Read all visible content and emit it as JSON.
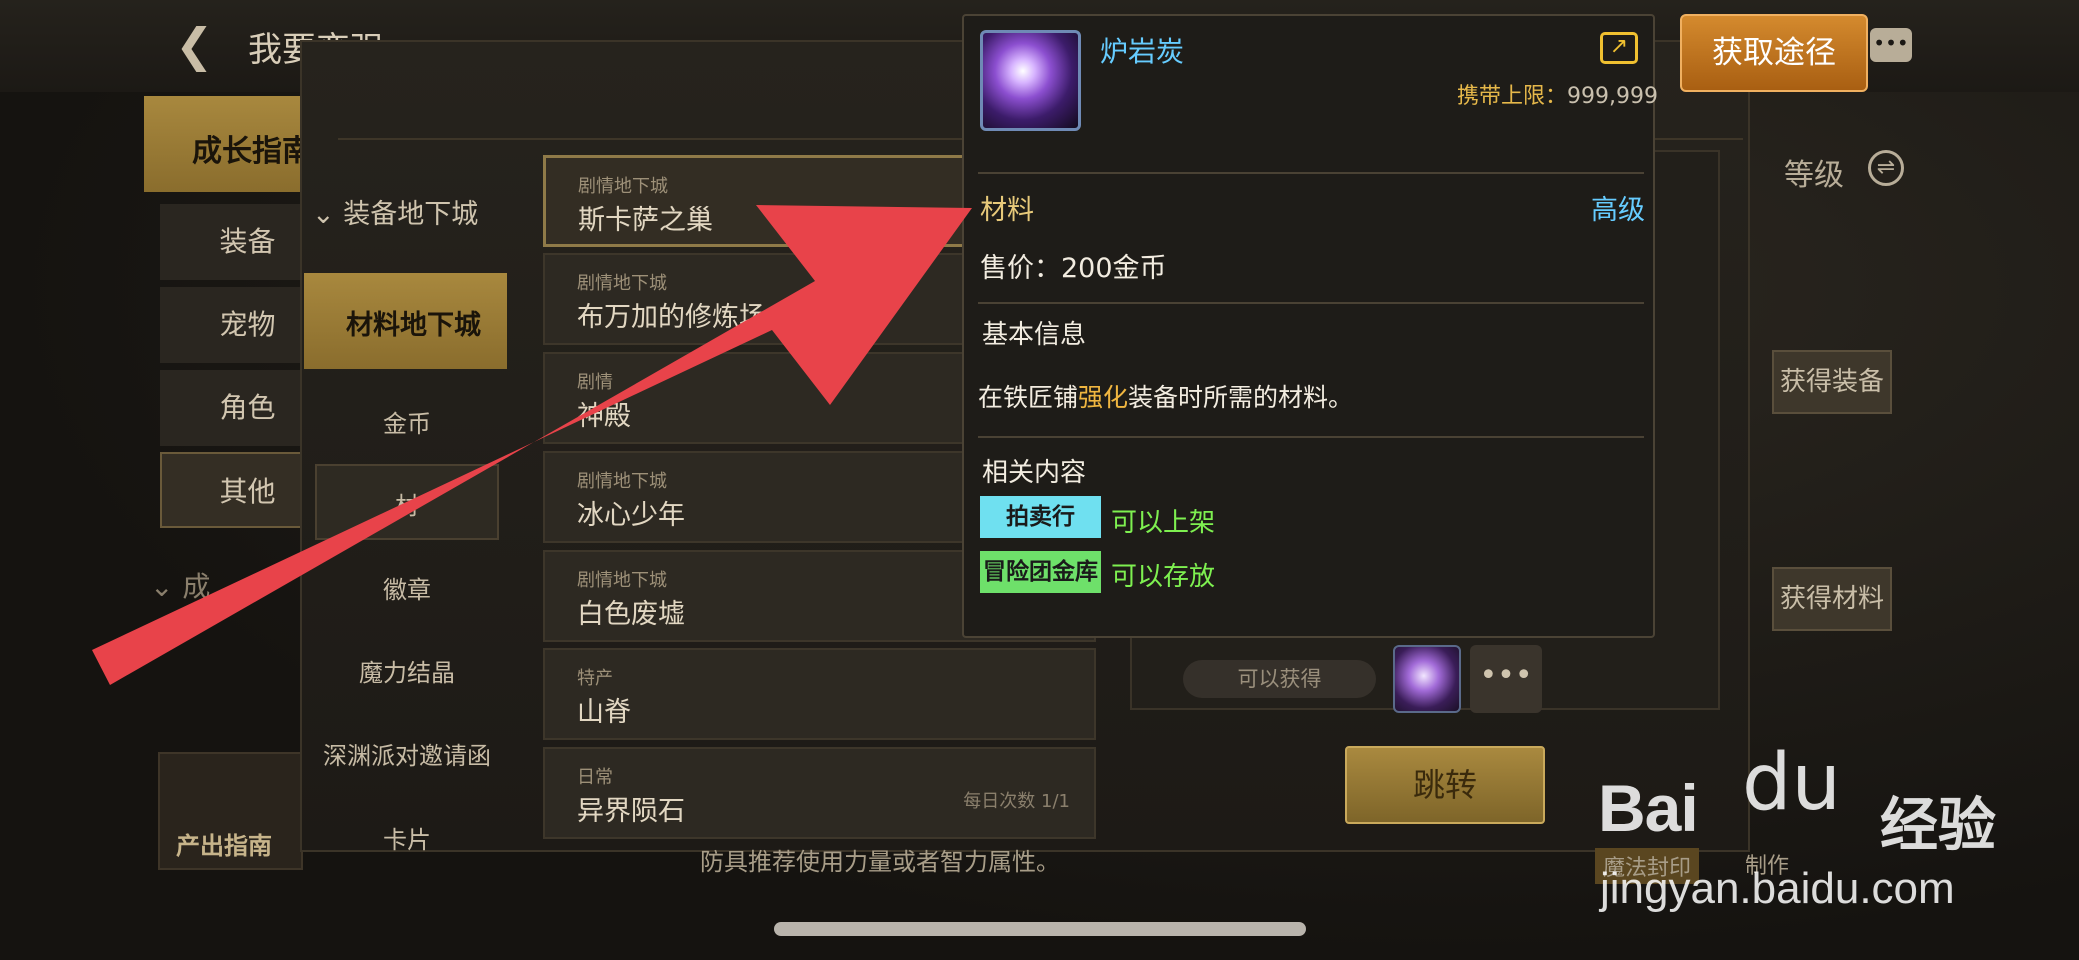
{
  "page": {
    "title": "我要变强"
  },
  "categories": {
    "header": "成长指南",
    "items": [
      "装备",
      "宠物",
      "角色",
      "其他"
    ],
    "header2": "成",
    "guide_label": "产出指南"
  },
  "subcategories": {
    "dungeon_equip": "装备地下城",
    "dungeon_material": "材料地下城",
    "items": [
      "金币",
      "材",
      "徽章",
      "魔力结晶",
      "深渊派对邀请函",
      "卡片"
    ]
  },
  "dungeons": [
    {
      "type": "剧情地下城",
      "name": "斯卡萨之巢",
      "count": ""
    },
    {
      "type": "剧情地下城",
      "name": "布万加的修炼场",
      "count": ""
    },
    {
      "type": "剧情",
      "name": "神殿",
      "count": ""
    },
    {
      "type": "剧情地下城",
      "name": "冰心少年",
      "count": ""
    },
    {
      "type": "剧情地下城",
      "name": "白色废墟",
      "count": ""
    },
    {
      "type": "特产",
      "name": "山脊",
      "count": ""
    },
    {
      "type": "日常",
      "name": "异界陨石",
      "count": "每日次数 1/1"
    }
  ],
  "right_panel": {
    "level_label": "等级",
    "btn_get_equip": "获得装备",
    "btn_get_material": "获得材料",
    "obtain_label": "可以获得",
    "more": "•••",
    "jump": "跳转",
    "hint": "防具推荐使用力量或者智力属性。",
    "seal": "魔法封印",
    "make": "制作"
  },
  "tooltip": {
    "name": "炉岩炭",
    "limit_label": "携带上限：",
    "limit_value": "999,999",
    "category": "材料",
    "grade": "高级",
    "price": "售价：200金币",
    "basic_info": "基本信息",
    "desc_pre": "在铁匠铺",
    "desc_hl": "强化",
    "desc_post": "装备时所需的材料。",
    "related": "相关内容",
    "tags": [
      {
        "label": "拍卖行",
        "note": "可以上架"
      },
      {
        "label": "冒险团金库",
        "note": "可以存放"
      }
    ]
  },
  "get_path_button": "获取途径",
  "watermark": {
    "logo": "Bai",
    "paw": "du",
    "cn": "经验",
    "url": "jingyan.baidu.com"
  },
  "colors": {
    "arrow": "#e8434a",
    "accent_gold": "#a8883e",
    "link_blue": "#66ccff",
    "green": "#7ef050"
  }
}
